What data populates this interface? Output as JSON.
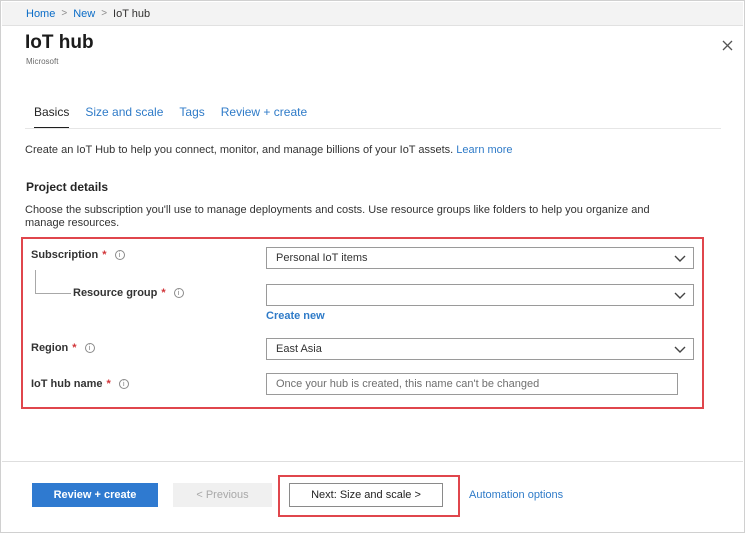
{
  "breadcrumb": [
    "Home",
    "New",
    "IoT hub"
  ],
  "header": {
    "title": "IoT hub",
    "subtitle": "Microsoft"
  },
  "tabs": [
    {
      "label": "Basics",
      "active": true
    },
    {
      "label": "Size and scale",
      "active": false
    },
    {
      "label": "Tags",
      "active": false
    },
    {
      "label": "Review + create",
      "active": false
    }
  ],
  "intro": {
    "text": "Create an IoT Hub to help you connect, monitor, and manage billions of your IoT assets.",
    "link": "Learn more"
  },
  "project": {
    "heading": "Project details",
    "description": "Choose the subscription you'll use to manage deployments and costs. Use resource groups like folders to help you organize and manage resources."
  },
  "form": {
    "subscription": {
      "label": "Subscription",
      "value": "Personal IoT items"
    },
    "resource_group": {
      "label": "Resource group",
      "value": "",
      "create_new": "Create new"
    },
    "region": {
      "label": "Region",
      "value": "East Asia"
    },
    "hub_name": {
      "label": "IoT hub name",
      "value": "",
      "placeholder": "Once your hub is created, this name can't be changed"
    },
    "required_marker": "*",
    "info_icon": "i"
  },
  "footer": {
    "review_create": "Review + create",
    "previous": "< Previous",
    "next": "Next: Size and scale >",
    "automation": "Automation options"
  },
  "icons": {
    "close": "close-icon",
    "chevron": "chevron-down-icon",
    "info": "info-icon"
  },
  "colors": {
    "accent": "#2f7ad0",
    "link": "#2f7bc8",
    "highlight": "#e0464c",
    "required": "#d13438"
  }
}
